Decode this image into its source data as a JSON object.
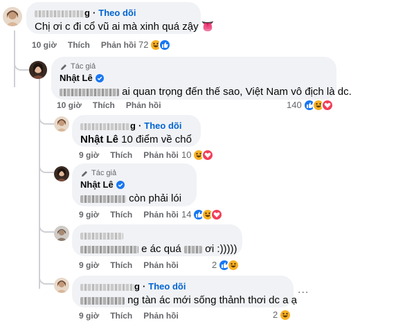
{
  "comments": [
    {
      "author_suffix": "g",
      "follow_label": "Theo dõi",
      "text": "Chị ơi c đi cổ vũ ai mà xinh quá zậy 👅",
      "time": "10 giờ",
      "like": "Thích",
      "reply": "Phản hồi",
      "reaction_count": "72",
      "reactions": [
        "haha",
        "like"
      ]
    },
    {
      "badge": "Tác giả",
      "author": "Nhật Lê",
      "text": "ai quan trọng đến thế sao, Việt Nam vô địch là dc.",
      "time": "10 giờ",
      "like": "Thích",
      "reply": "Phản hồi",
      "reaction_count": "140",
      "reactions": [
        "like",
        "haha",
        "love"
      ]
    },
    {
      "author_suffix": "g",
      "follow_label": "Theo dõi",
      "mention": "Nhật Lê",
      "text": " 10 điểm về chổ",
      "time": "9 giờ",
      "like": "Thích",
      "reply": "Phản hồi",
      "reaction_count": "10",
      "reactions": [
        "haha",
        "love"
      ]
    },
    {
      "badge": "Tác giả",
      "author": "Nhật Lê",
      "text": "còn phải lói",
      "time": "9 giờ",
      "like": "Thích",
      "reply": "Phản hồi",
      "reaction_count": "14",
      "reactions": [
        "like",
        "haha",
        "love"
      ]
    },
    {
      "text": "e ác quá",
      "text_tail": "ơi :)))))",
      "time": "9 giờ",
      "like": "Thích",
      "reply": "Phản hồi",
      "reaction_count": "2",
      "reactions": [
        "like",
        "haha"
      ]
    },
    {
      "author_suffix": "g",
      "follow_label": "Theo dõi",
      "text": "ng tàn ác mới sống thảnh thơi dc a ạ",
      "time": "9 giờ",
      "like": "Thích",
      "reply": "Phản hồi",
      "reaction_count": "2",
      "reactions": [
        "haha"
      ],
      "more": "..."
    }
  ],
  "icons": {
    "author_badge": "pencil-icon",
    "verified": "verified-badge-icon",
    "like": "like-reaction-icon",
    "haha": "haha-reaction-icon",
    "love": "love-reaction-icon",
    "more": "more-options-icon"
  },
  "colors": {
    "link": "#0064d1",
    "bubble": "#f0f2f5",
    "meta": "#65676b",
    "like": "#1877f2",
    "love": "#f33e58",
    "haha": "#f7b125"
  }
}
